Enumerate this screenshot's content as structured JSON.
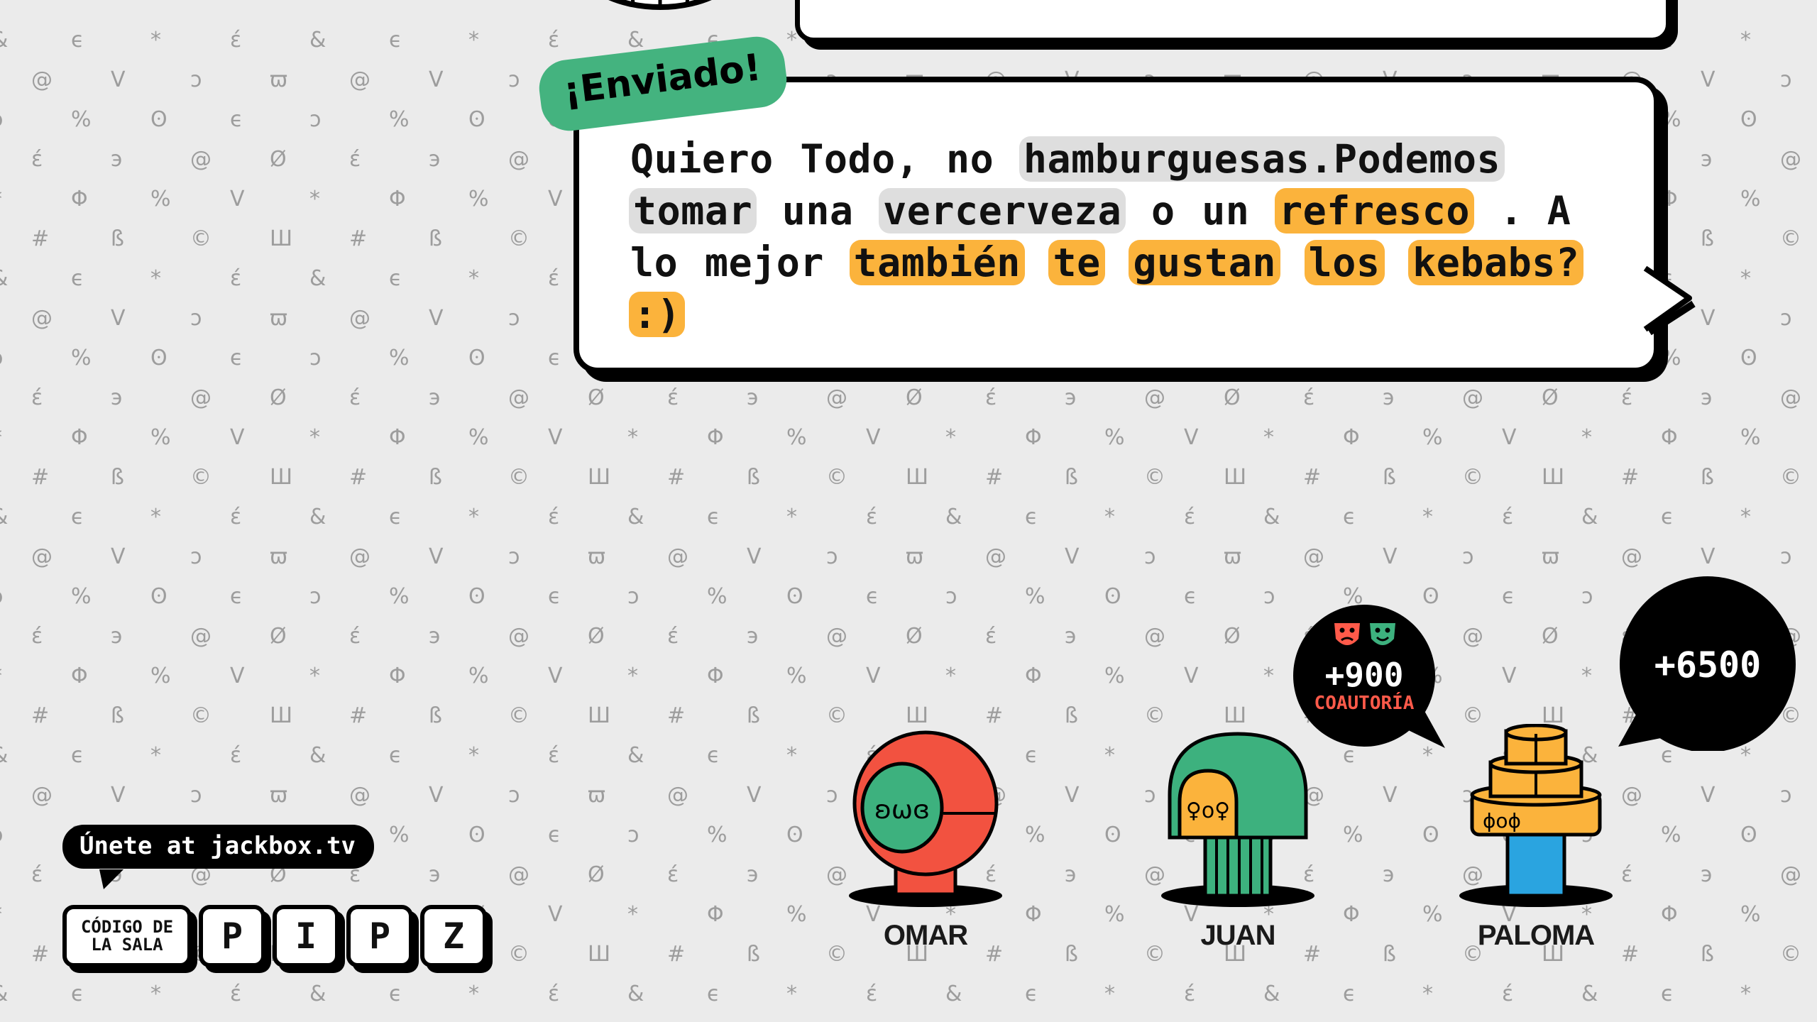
{
  "message": {
    "sent_label": "¡Enviado!",
    "words": [
      {
        "t": "Quiero",
        "s": "plain"
      },
      {
        "t": "Todo,",
        "s": "plain"
      },
      {
        "t": "no",
        "s": "plain"
      },
      {
        "t": "hamburguesas.Podemos",
        "s": "gray"
      },
      {
        "t": "tomar",
        "s": "gray"
      },
      {
        "t": "una",
        "s": "plain"
      },
      {
        "t": "vercerveza",
        "s": "gray"
      },
      {
        "t": "o",
        "s": "plain"
      },
      {
        "t": "un",
        "s": "plain"
      },
      {
        "t": "refresco",
        "s": "orange"
      },
      {
        "t": ". A",
        "s": "plain"
      },
      {
        "t": "lo",
        "s": "plain"
      },
      {
        "t": "mejor",
        "s": "plain"
      },
      {
        "t": "también",
        "s": "orange"
      },
      {
        "t": "te",
        "s": "orange"
      },
      {
        "t": "gustan",
        "s": "orange"
      },
      {
        "t": "los",
        "s": "orange"
      },
      {
        "t": "kebabs?",
        "s": "orange"
      },
      {
        "t": ":)",
        "s": "orange"
      }
    ]
  },
  "join": {
    "text": "Únete at jackbox.tv",
    "room_code_label": "CÓDIGO DE LA SALA",
    "room_code": [
      "P",
      "I",
      "P",
      "Z"
    ]
  },
  "players": [
    {
      "name": "OMAR",
      "avatar_icon": "red-round-head-icon"
    },
    {
      "name": "JUAN",
      "avatar_icon": "green-dome-head-icon"
    },
    {
      "name": "PALOMA",
      "avatar_icon": "orange-stacked-cake-icon"
    }
  ],
  "scores": [
    {
      "player": "JUAN",
      "value": "+900",
      "label": "COAUTORÍA",
      "icon": "theater-masks-icon"
    },
    {
      "player": "PALOMA",
      "value": "+6500",
      "label": ""
    }
  ],
  "colors": {
    "background": "#ebebeb",
    "pattern": "#9d9d9d",
    "gray_highlight": "#dedede",
    "orange_highlight": "#fbb33c",
    "sent_green": "#44b37f",
    "coauthor_red": "#ff5a4a",
    "omar_red": "#f25240",
    "juan_green": "#3db17e",
    "paloma_orange": "#fbb33c",
    "paloma_blue": "#2aa4e0"
  }
}
